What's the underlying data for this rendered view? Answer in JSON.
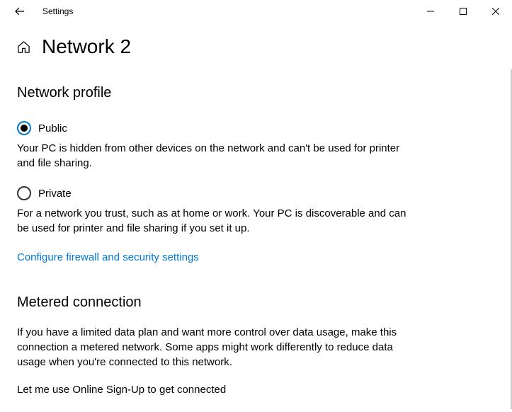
{
  "titlebar": {
    "title": "Settings"
  },
  "page": {
    "title": "Network 2"
  },
  "networkProfile": {
    "heading": "Network profile",
    "public": {
      "label": "Public",
      "description": "Your PC is hidden from other devices on the network and can't be used for printer and file sharing.",
      "selected": true
    },
    "private": {
      "label": "Private",
      "description": "For a network you trust, such as at home or work. Your PC is discoverable and can be used for printer and file sharing if you set it up.",
      "selected": false
    },
    "link": "Configure firewall and security settings"
  },
  "metered": {
    "heading": "Metered connection",
    "description": "If you have a limited data plan and want more control over data usage, make this connection a metered network. Some apps might work differently to reduce data usage when you're connected to this network.",
    "truncated": "Let me use Online Sign-Up to get connected"
  },
  "colors": {
    "accent": "#0078d4"
  }
}
